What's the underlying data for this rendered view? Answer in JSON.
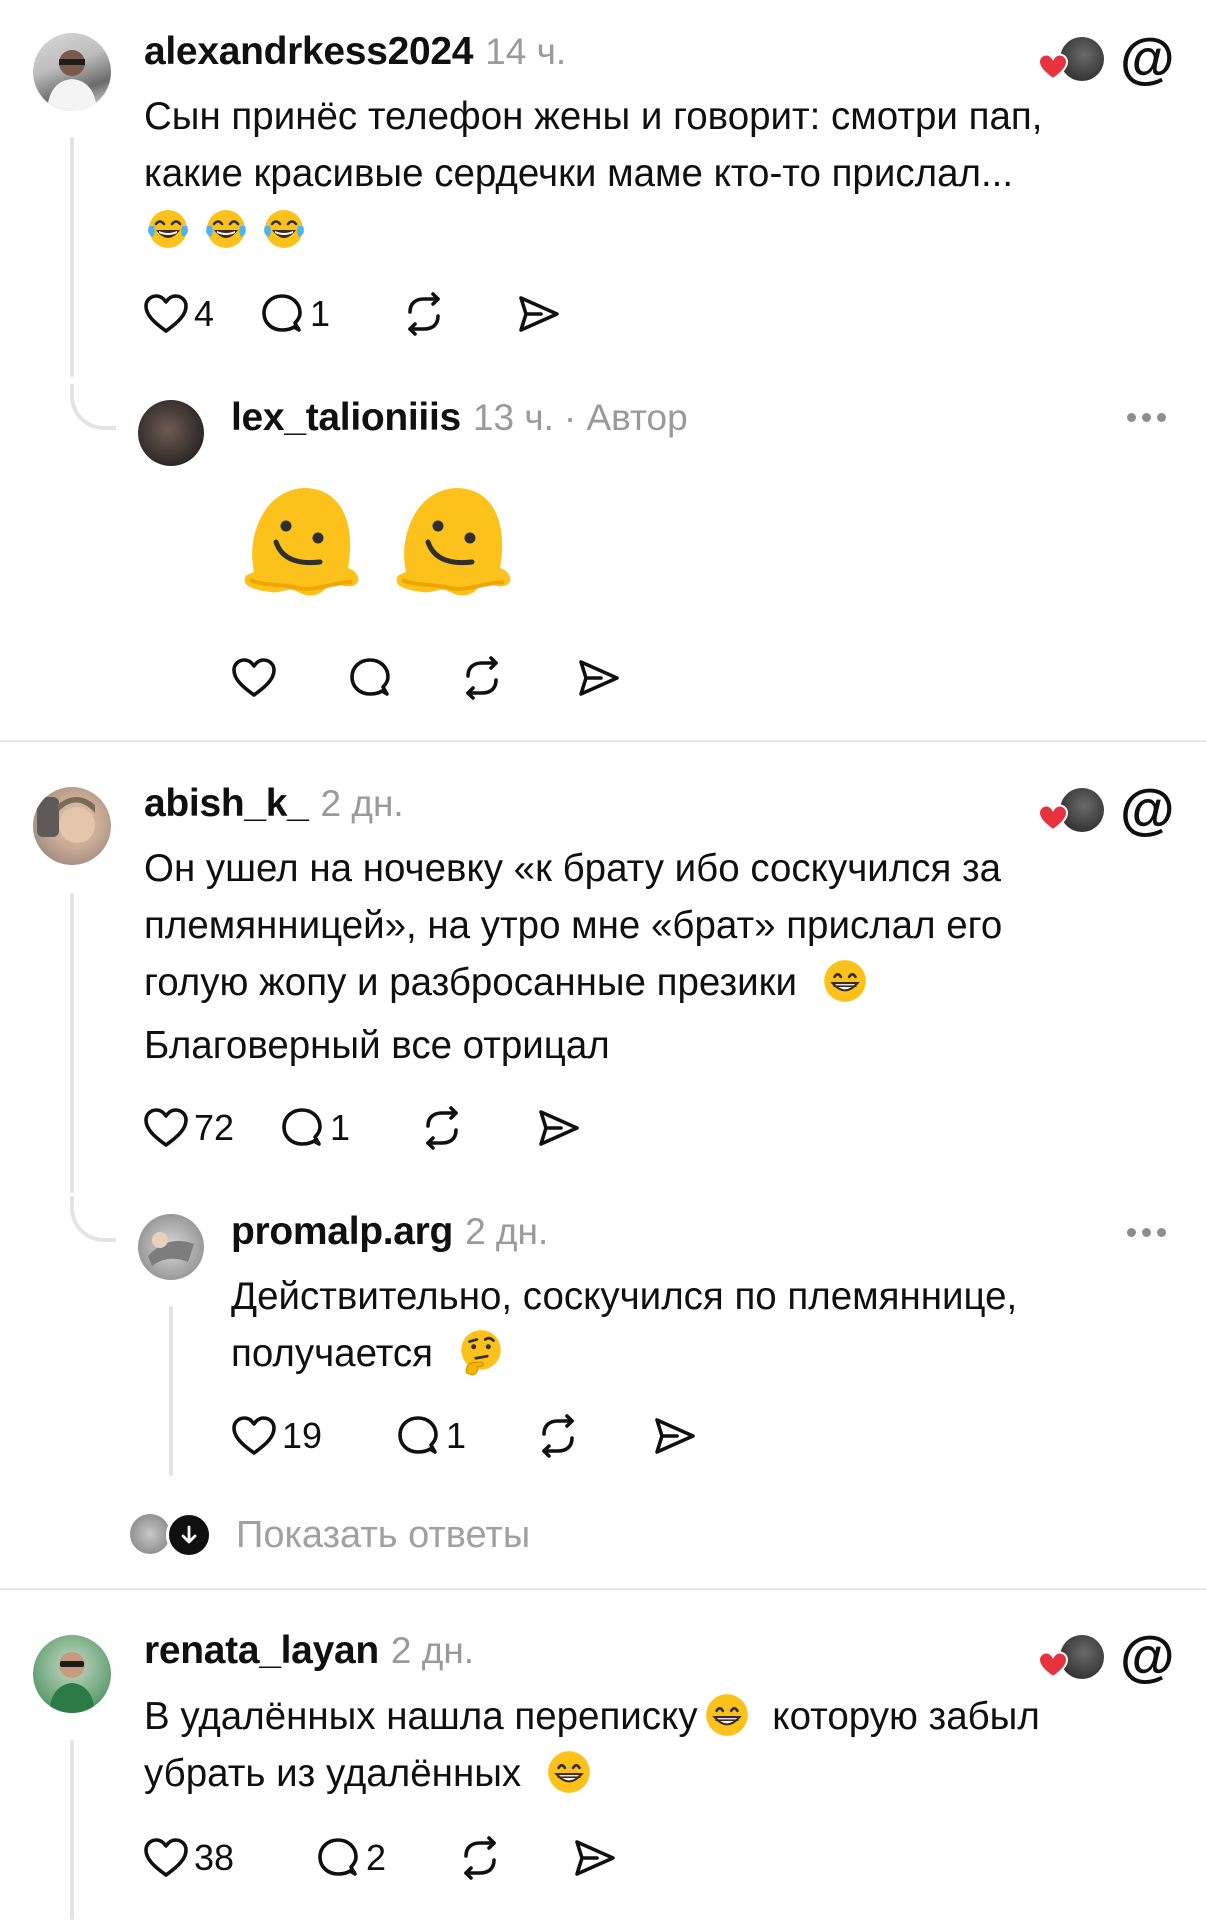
{
  "comments": [
    {
      "username": "alexandrkess2024",
      "time": "14 ч.",
      "text_lines": [
        "Сын принёс телефон жены и говорит: смотри пап,",
        "какие красивые сердечки маме кто-то прислал..."
      ],
      "emoji_line": [
        "face-with-tears-of-joy",
        "face-with-tears-of-joy",
        "face-with-tears-of-joy"
      ],
      "likes": "4",
      "replies": "1",
      "reply": {
        "username": "lex_talioniiis",
        "time": "13 ч.",
        "author_tag": "· Автор",
        "emojis": [
          "melting-face",
          "melting-face"
        ]
      }
    },
    {
      "username": "abish_k_",
      "time": "2 дн.",
      "text_lines": [
        "Он ушел на ночевку «к брату ибо соскучился за",
        "племянницей», на утро мне «брат» прислал его",
        "голую жопу и разбросанные презики",
        "Благоверный все отрицал"
      ],
      "likes": "72",
      "replies": "1",
      "reply": {
        "username": "promalp.arg",
        "time": "2 дн.",
        "text_lines": [
          "Действительно, соскучился по племяннице,",
          "получается"
        ],
        "likes": "19",
        "replies": "1"
      },
      "show_replies": "Показать ответы"
    },
    {
      "username": "renata_layan",
      "time": "2 дн.",
      "text_lines": [
        "В удалённых нашла переписку",
        "которую забыл",
        "убрать из удалённых"
      ],
      "likes": "38",
      "replies": "2"
    }
  ],
  "icons": {
    "like": "heart-outline-icon",
    "reply": "speech-bubble-icon",
    "repost": "repost-icon",
    "share": "send-icon",
    "platform": "threads-logo-icon",
    "liked_by_author": "red-heart-icon"
  },
  "colors": {
    "text": "#101010",
    "muted": "#9a9a9a",
    "heart": "#e8323f",
    "line": "#e3e3e3"
  }
}
